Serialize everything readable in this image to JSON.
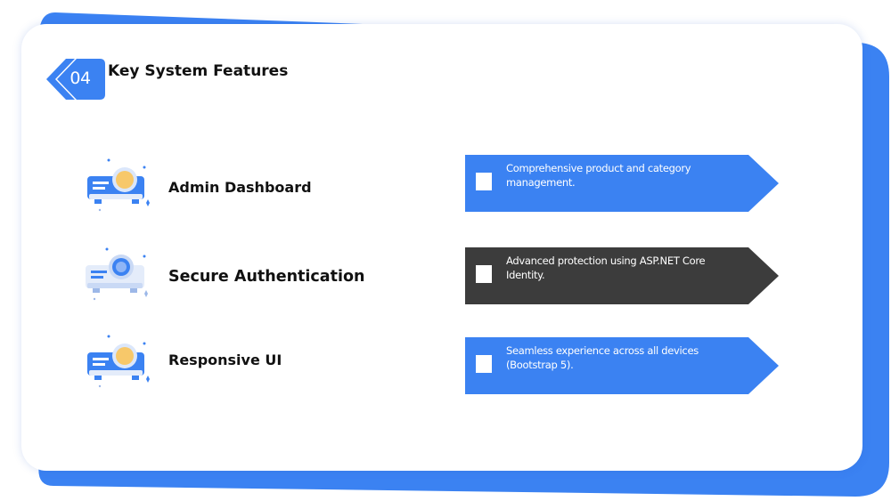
{
  "slide": {
    "number": "04",
    "title": "Key System Features"
  },
  "colors": {
    "accent_blue": "#3b82f2",
    "dark_gray": "#3c3c3c",
    "text": "#111111",
    "icon_yellow": "#f7c86a"
  },
  "features": [
    {
      "title": "Admin Dashboard",
      "description": "Comprehensive product and category management.",
      "icon": "projector-icon",
      "banner_color": "#3b82f2"
    },
    {
      "title": "Secure Authentication",
      "description": "Advanced protection using ASP.NET Core Identity.",
      "icon": "projector-icon",
      "banner_color": "#3c3c3c"
    },
    {
      "title": "Responsive UI",
      "description": "Seamless experience across all devices (Bootstrap 5).",
      "icon": "projector-icon",
      "banner_color": "#3b82f2"
    }
  ]
}
